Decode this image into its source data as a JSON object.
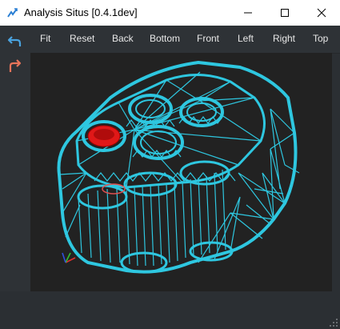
{
  "window": {
    "title": "Analysis Situs [0.4.1dev]",
    "controls": {
      "minimize": "minimize",
      "maximize": "maximize",
      "close": "close"
    }
  },
  "toolbar": {
    "buttons": [
      {
        "label": "Fit"
      },
      {
        "label": "Reset"
      },
      {
        "label": "Back"
      },
      {
        "label": "Bottom"
      },
      {
        "label": "Front"
      },
      {
        "label": "Left"
      },
      {
        "label": "Right"
      },
      {
        "label": "Top"
      }
    ]
  },
  "sidebar": {
    "buttons": [
      {
        "icon": "undo-icon",
        "color": "#4aa3df"
      },
      {
        "icon": "redo-icon",
        "color": "#e8745a"
      }
    ]
  },
  "viewport": {
    "background": "#222222",
    "mesh_color": "#2ec7e0",
    "highlight_color": "#e01818",
    "axes": {
      "x_color": "#e03030",
      "y_color": "#30c030",
      "z_color": "#3050e0"
    }
  }
}
